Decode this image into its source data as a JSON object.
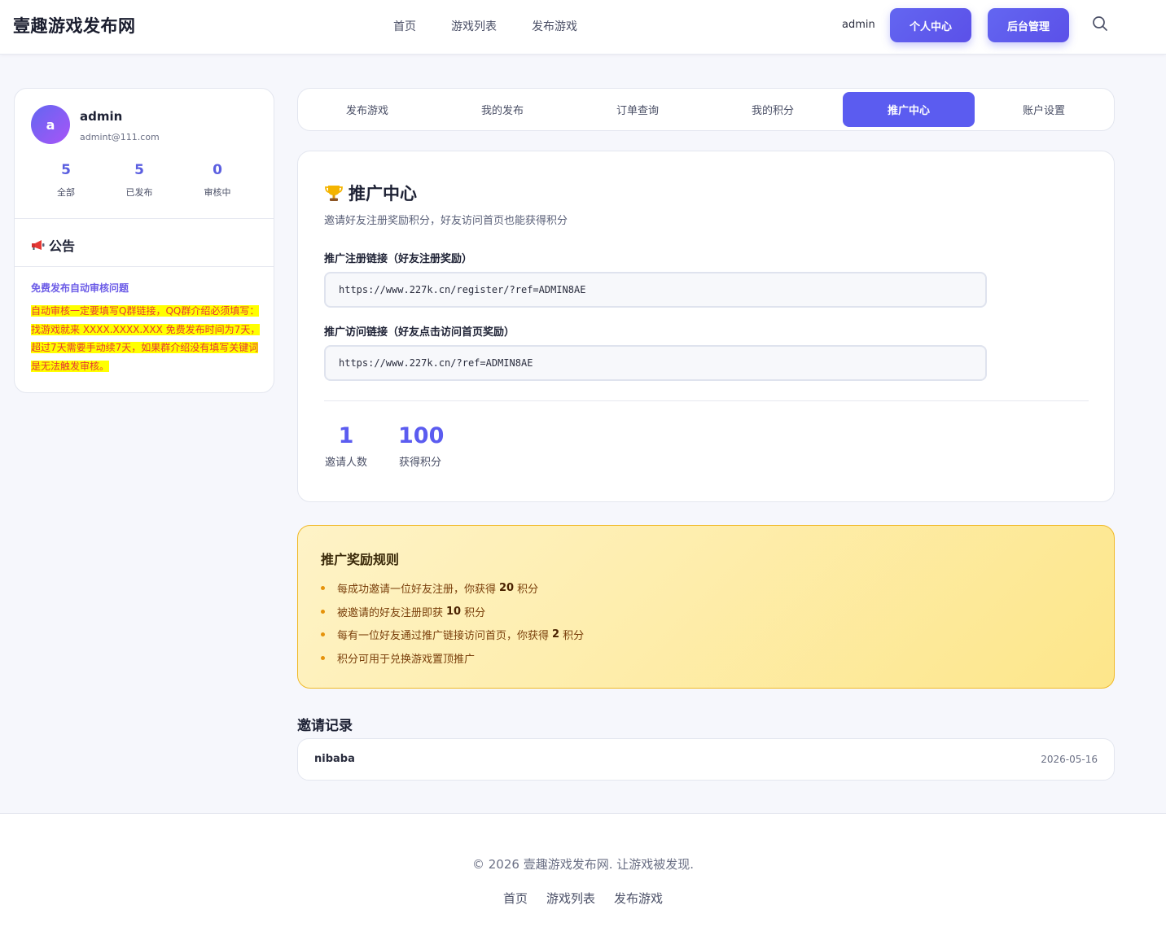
{
  "header": {
    "logo": "壹趣游戏发布网",
    "nav": [
      "首页",
      "游戏列表",
      "发布游戏"
    ],
    "username": "admin",
    "btn_profile": "个人中心",
    "btn_admin": "后台管理"
  },
  "profile": {
    "avatar_letter": "a",
    "name": "admin",
    "email": "admint@111.com",
    "stats": [
      {
        "value": "5",
        "label": "全部"
      },
      {
        "value": "5",
        "label": "已发布"
      },
      {
        "value": "0",
        "label": "审核中"
      }
    ]
  },
  "announcement": {
    "title": "公告",
    "link": "免费发布自动审核问题",
    "body": "自动审核一定要填写Q群链接，QQ群介绍必须填写：找游戏就来 XXXX.XXXX.XXX 免费发布时间为7天，超过7天需要手动续7天，如果群介绍没有填写关键词是无法触发审核。"
  },
  "tabs": [
    "发布游戏",
    "我的发布",
    "订单查询",
    "我的积分",
    "推广中心",
    "账户设置"
  ],
  "active_tab": "推广中心",
  "promo": {
    "title": "推广中心",
    "subtitle": "邀请好友注册奖励积分，好友访问首页也能获得积分",
    "register_label": "推广注册链接（好友注册奖励）",
    "register_link": "https://www.227k.cn/register/?ref=ADMIN8AE",
    "visit_label": "推广访问链接（好友点击访问首页奖励）",
    "visit_link": "https://www.227k.cn/?ref=ADMIN8AE",
    "invited_count": "1",
    "invited_label": "邀请人数",
    "points": "100",
    "points_label": "获得积分"
  },
  "rules": {
    "title": "推广奖励规则",
    "items": [
      {
        "pre": "每成功邀请一位好友注册，你获得",
        "num": "20",
        "post": "积分"
      },
      {
        "pre": "被邀请的好友注册即获",
        "num": "10",
        "post": "积分"
      },
      {
        "pre": "每有一位好友通过推广链接访问首页，你获得",
        "num": "2",
        "post": "积分"
      },
      {
        "pre": "积分可用于兑换游戏置顶推广",
        "num": "",
        "post": ""
      }
    ]
  },
  "records": {
    "title": "邀请记录",
    "rows": [
      {
        "name": "nibaba",
        "date": "2026-05-16"
      }
    ]
  },
  "footer": {
    "copyright": "© 2026 壹趣游戏发布网. 让游戏被发现.",
    "links": [
      "首页",
      "游戏列表",
      "发布游戏"
    ]
  },
  "colors": {
    "accent": "#5b5cf0",
    "announcement_text": "#e53935",
    "announcement_highlight": "#ffff00",
    "rules_bg": "#fde68a"
  },
  "icons": [
    "search-icon",
    "megaphone-icon",
    "trophy-icon"
  ]
}
